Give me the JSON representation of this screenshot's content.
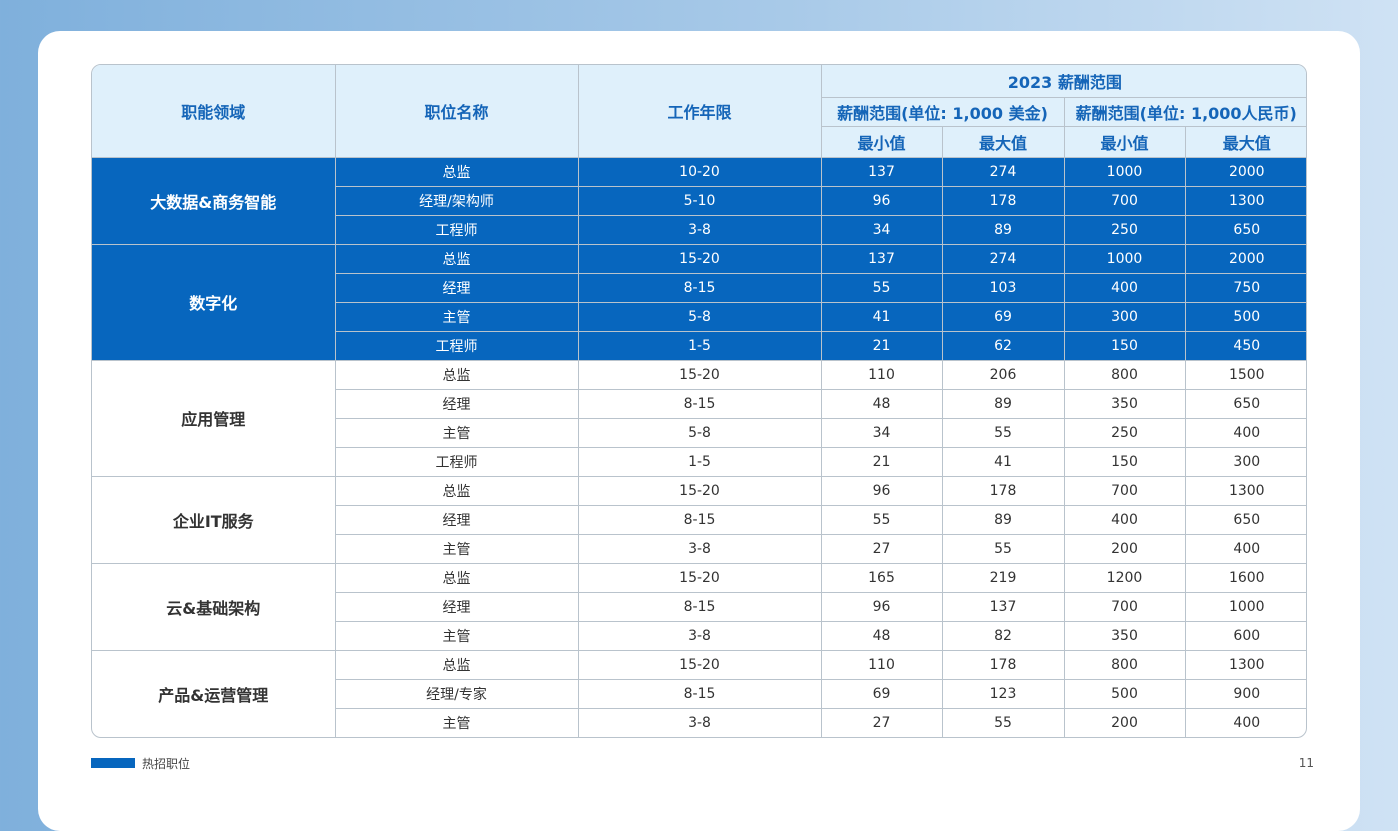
{
  "headers": {
    "domain": "职能领域",
    "position": "职位名称",
    "years": "工作年限",
    "range_title": "2023 薪酬范围",
    "usd": "薪酬范围(单位: 1,000 美金)",
    "rmb": "薪酬范围(单位: 1,000人民币)",
    "min": "最小值",
    "max": "最大值"
  },
  "groups": [
    {
      "domain": "大数据&商务智能",
      "highlight": true,
      "rows": [
        {
          "position": "总监",
          "years": "10-20",
          "usd_min": "137",
          "usd_max": "274",
          "rmb_min": "1000",
          "rmb_max": "2000"
        },
        {
          "position": "经理/架构师",
          "years": "5-10",
          "usd_min": "96",
          "usd_max": "178",
          "rmb_min": "700",
          "rmb_max": "1300"
        },
        {
          "position": "工程师",
          "years": "3-8",
          "usd_min": "34",
          "usd_max": "89",
          "rmb_min": "250",
          "rmb_max": "650"
        }
      ]
    },
    {
      "domain": "数字化",
      "highlight": true,
      "rows": [
        {
          "position": "总监",
          "years": "15-20",
          "usd_min": "137",
          "usd_max": "274",
          "rmb_min": "1000",
          "rmb_max": "2000"
        },
        {
          "position": "经理",
          "years": "8-15",
          "usd_min": "55",
          "usd_max": "103",
          "rmb_min": "400",
          "rmb_max": "750"
        },
        {
          "position": "主管",
          "years": "5-8",
          "usd_min": "41",
          "usd_max": "69",
          "rmb_min": "300",
          "rmb_max": "500"
        },
        {
          "position": "工程师",
          "years": "1-5",
          "usd_min": "21",
          "usd_max": "62",
          "rmb_min": "150",
          "rmb_max": "450"
        }
      ]
    },
    {
      "domain": "应用管理",
      "highlight": false,
      "rows": [
        {
          "position": "总监",
          "years": "15-20",
          "usd_min": "110",
          "usd_max": "206",
          "rmb_min": "800",
          "rmb_max": "1500"
        },
        {
          "position": "经理",
          "years": "8-15",
          "usd_min": "48",
          "usd_max": "89",
          "rmb_min": "350",
          "rmb_max": "650"
        },
        {
          "position": "主管",
          "years": "5-8",
          "usd_min": "34",
          "usd_max": "55",
          "rmb_min": "250",
          "rmb_max": "400"
        },
        {
          "position": "工程师",
          "years": "1-5",
          "usd_min": "21",
          "usd_max": "41",
          "rmb_min": "150",
          "rmb_max": "300"
        }
      ]
    },
    {
      "domain": "企业IT服务",
      "highlight": false,
      "rows": [
        {
          "position": "总监",
          "years": "15-20",
          "usd_min": "96",
          "usd_max": "178",
          "rmb_min": "700",
          "rmb_max": "1300"
        },
        {
          "position": "经理",
          "years": "8-15",
          "usd_min": "55",
          "usd_max": "89",
          "rmb_min": "400",
          "rmb_max": "650"
        },
        {
          "position": "主管",
          "years": "3-8",
          "usd_min": "27",
          "usd_max": "55",
          "rmb_min": "200",
          "rmb_max": "400"
        }
      ]
    },
    {
      "domain": "云&基础架构",
      "highlight": false,
      "rows": [
        {
          "position": "总监",
          "years": "15-20",
          "usd_min": "165",
          "usd_max": "219",
          "rmb_min": "1200",
          "rmb_max": "1600"
        },
        {
          "position": "经理",
          "years": "8-15",
          "usd_min": "96",
          "usd_max": "137",
          "rmb_min": "700",
          "rmb_max": "1000"
        },
        {
          "position": "主管",
          "years": "3-8",
          "usd_min": "48",
          "usd_max": "82",
          "rmb_min": "350",
          "rmb_max": "600"
        }
      ]
    },
    {
      "domain": "产品&运营管理",
      "highlight": false,
      "rows": [
        {
          "position": "总监",
          "years": "15-20",
          "usd_min": "110",
          "usd_max": "178",
          "rmb_min": "800",
          "rmb_max": "1300"
        },
        {
          "position": "经理/专家",
          "years": "8-15",
          "usd_min": "69",
          "usd_max": "123",
          "rmb_min": "500",
          "rmb_max": "900"
        },
        {
          "position": "主管",
          "years": "3-8",
          "usd_min": "27",
          "usd_max": "55",
          "rmb_min": "200",
          "rmb_max": "400"
        }
      ]
    }
  ],
  "footer": {
    "label": "热招职位",
    "page": "11"
  },
  "colors": {
    "accent": "#0766be",
    "header_bg": "#dff0fb",
    "header_text": "#1565b8"
  }
}
